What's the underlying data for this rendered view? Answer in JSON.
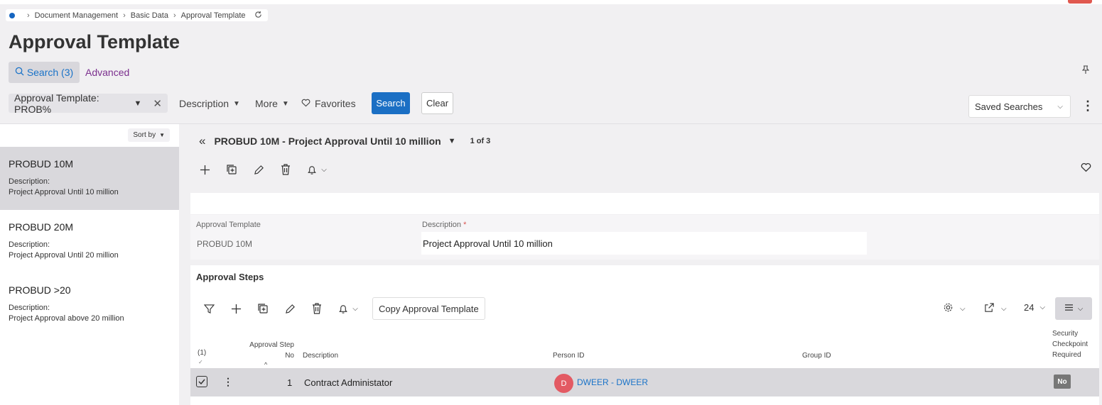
{
  "breadcrumb": {
    "items": [
      "Document Management",
      "Basic Data",
      "Approval Template"
    ]
  },
  "page": {
    "title": "Approval Template"
  },
  "tabs": {
    "search_label": "Search (3)",
    "advanced_label": "Advanced"
  },
  "filters": {
    "chip_label": "Approval Template: PROB%",
    "description_label": "Description",
    "more_label": "More",
    "favorites_label": "Favorites",
    "search_button": "Search",
    "clear_button": "Clear",
    "saved_searches": "Saved Searches"
  },
  "list": {
    "sort_label": "Sort by",
    "items": [
      {
        "name": "PROBUD 10M",
        "desc_label": "Description:",
        "desc": "Project Approval Until 10 million",
        "selected": true
      },
      {
        "name": "PROBUD 20M",
        "desc_label": "Description:",
        "desc": "Project Approval Until 20 million",
        "selected": false
      },
      {
        "name": "PROBUD >20",
        "desc_label": "Description:",
        "desc": "Project Approval above 20 million",
        "selected": false
      }
    ]
  },
  "record": {
    "title": "PROBUD 10M - Project Approval Until 10 million",
    "count": "1 of 3"
  },
  "form": {
    "template_label": "Approval Template",
    "template_value": "PROBUD 10M",
    "description_label": "Description",
    "required_marker": "*",
    "description_value": "Project Approval Until 10 million"
  },
  "steps": {
    "title": "Approval Steps",
    "copy_button": "Copy Approval Template",
    "page_size": "24",
    "headers": {
      "selected_count": "(1)",
      "step_no_line1": "Approval Step",
      "step_no_line2": "No",
      "description": "Description",
      "person_id": "Person ID",
      "group_id": "Group ID",
      "security_line1": "Security",
      "security_line2": "Checkpoint",
      "security_line3": "Required"
    },
    "rows": [
      {
        "step_no": "1",
        "description": "Contract Administator",
        "avatar_initial": "D",
        "person": "DWEER - DWEER",
        "group": "",
        "security": "No"
      }
    ]
  },
  "colors": {
    "primary": "#1b6fc4",
    "link": "#1a73c8",
    "advanced": "#7b2f8e",
    "avatar": "#e35a63",
    "selected_bg": "#d9d8dc"
  }
}
